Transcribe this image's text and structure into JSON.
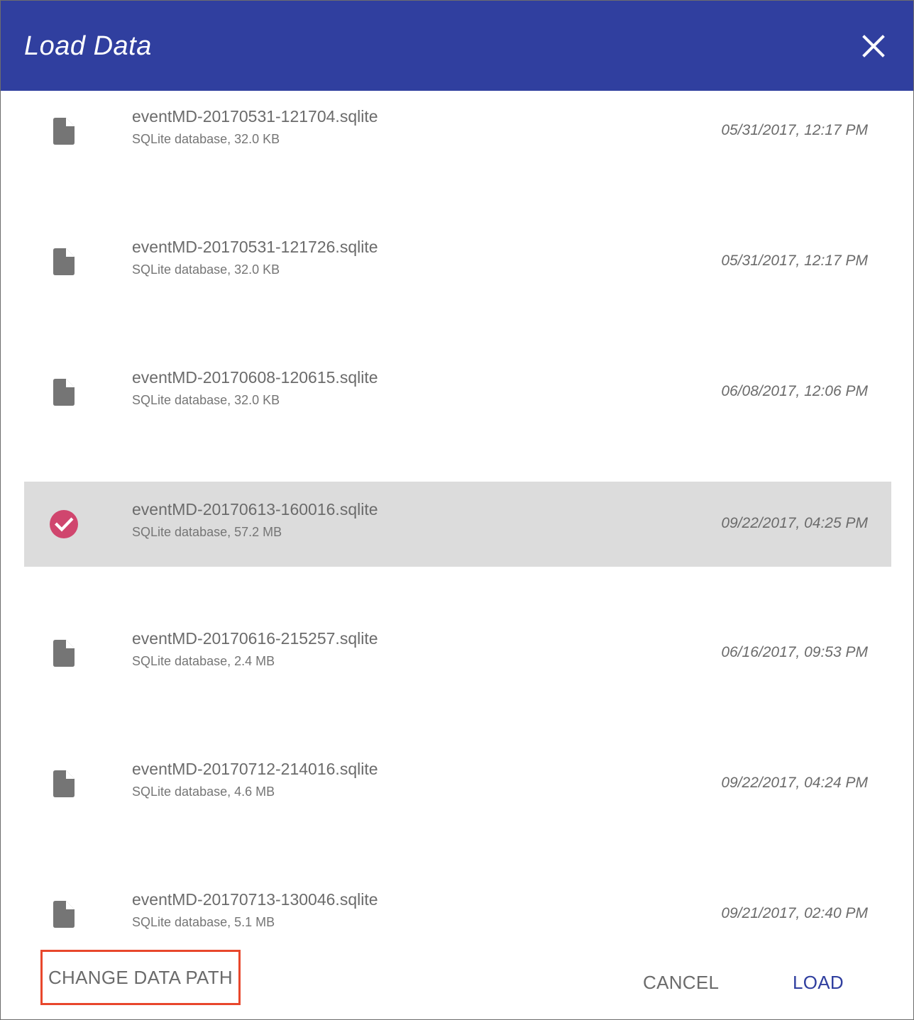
{
  "dialog": {
    "title": "Load Data",
    "close_icon": "close-icon",
    "header_color": "#303f9f"
  },
  "files": [
    {
      "name": "eventMD-20170531-121704.sqlite",
      "meta": "SQLite database, 32.0 KB",
      "date": "05/31/2017, 12:17 PM",
      "selected": false,
      "icon": "file-icon"
    },
    {
      "name": "eventMD-20170531-121726.sqlite",
      "meta": "SQLite database, 32.0 KB",
      "date": "05/31/2017, 12:17 PM",
      "selected": false,
      "icon": "file-icon"
    },
    {
      "name": "eventMD-20170608-120615.sqlite",
      "meta": "SQLite database, 32.0 KB",
      "date": "06/08/2017, 12:06 PM",
      "selected": false,
      "icon": "file-icon"
    },
    {
      "name": "eventMD-20170613-160016.sqlite",
      "meta": "SQLite database, 57.2 MB",
      "date": "09/22/2017, 04:25 PM",
      "selected": true,
      "icon": "check-circle-icon"
    },
    {
      "name": "eventMD-20170616-215257.sqlite",
      "meta": "SQLite database, 2.4 MB",
      "date": "06/16/2017, 09:53 PM",
      "selected": false,
      "icon": "file-icon"
    },
    {
      "name": "eventMD-20170712-214016.sqlite",
      "meta": "SQLite database, 4.6 MB",
      "date": "09/22/2017, 04:24 PM",
      "selected": false,
      "icon": "file-icon"
    },
    {
      "name": "eventMD-20170713-130046.sqlite",
      "meta": "SQLite database, 5.1 MB",
      "date": "09/21/2017, 02:40 PM",
      "selected": false,
      "icon": "file-icon"
    }
  ],
  "footer": {
    "change_path_label": "CHANGE DATA PATH",
    "cancel_label": "CANCEL",
    "load_label": "LOAD"
  },
  "colors": {
    "accent": "#303f9f",
    "selected_check": "#d0466e",
    "highlight_border": "#e8472c"
  }
}
